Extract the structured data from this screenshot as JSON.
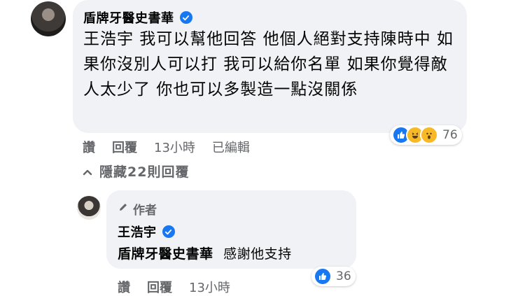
{
  "comment": {
    "author": "盾牌牙醫史書華",
    "text": "王浩宇 我可以幫他回答 他個人絕對支持陳時中 如果你沒別人可以打 我可以給你名單 如果你覺得敵人太少了 你也可以多製造一點沒關係",
    "reaction_count": "76",
    "reactions": [
      "like-icon",
      "haha-icon",
      "wow-icon"
    ],
    "actions": {
      "like": "讚",
      "reply": "回覆",
      "time": "13小時",
      "edited": "已編輯"
    }
  },
  "hide_replies": "隱藏22則回覆",
  "reply": {
    "author_badge": "作者",
    "author": "王浩宇",
    "mention": "盾牌牙醫史書華",
    "text": "感謝他支持",
    "reaction_count": "36",
    "actions": {
      "like": "讚",
      "reply": "回覆",
      "time": "13小時"
    }
  },
  "colors": {
    "accent": "#1877f2",
    "bubble": "#f0f2f5",
    "meta": "#65676b"
  }
}
